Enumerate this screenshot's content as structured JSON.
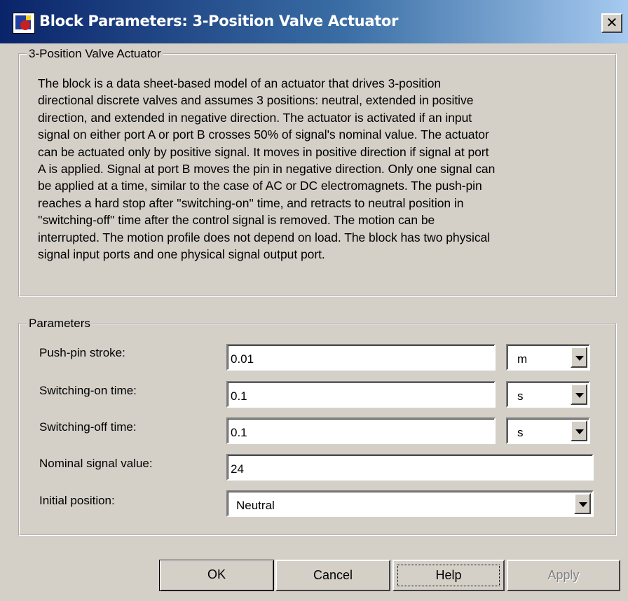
{
  "window": {
    "title": "Block Parameters: 3-Position Valve Actuator",
    "close_label": "✕"
  },
  "description_group": {
    "legend": "3-Position Valve Actuator",
    "lines": [
      "The block is a data sheet-based model of an actuator that drives 3-position",
      "directional discrete valves and assumes 3 positions: neutral, extended in positive",
      "direction, and extended in negative direction. The actuator is activated if an input",
      "signal on either port A or port B crosses 50% of signal's nominal value. The actuator",
      "can be actuated only by positive signal. It moves in positive direction if signal at port",
      "A is applied. Signal at port B moves the pin in negative direction. Only one signal can",
      "be applied at a time, similar to the case of AC or DC electromagnets. The push-pin",
      "reaches a hard stop after ''switching-on'' time, and retracts to neutral position in",
      "''switching-off'' time after the control signal is removed. The motion can be",
      "interrupted. The motion profile does not depend on load. The block has two physical",
      "signal input ports and one physical signal output port."
    ]
  },
  "parameters": {
    "legend": "Parameters",
    "push_pin_stroke": {
      "label": "Push-pin stroke:",
      "value": "0.01",
      "unit": "m"
    },
    "switching_on_time": {
      "label": "Switching-on time:",
      "value": "0.1",
      "unit": "s"
    },
    "switching_off_time": {
      "label": "Switching-off time:",
      "value": "0.1",
      "unit": "s"
    },
    "nominal_signal_value": {
      "label": "Nominal signal value:",
      "value": "24"
    },
    "initial_position": {
      "label": "Initial position:",
      "value": "Neutral"
    }
  },
  "buttons": {
    "ok": "OK",
    "cancel": "Cancel",
    "help": "Help",
    "apply": "Apply"
  },
  "colors": {
    "titlebar_start": "#0a246a",
    "titlebar_end": "#a6caf0",
    "face": "#d4d0c8"
  }
}
